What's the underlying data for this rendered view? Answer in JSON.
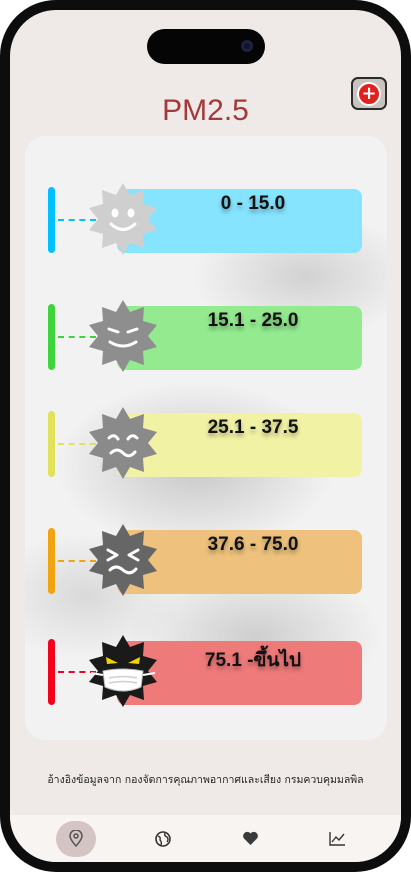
{
  "header": {
    "title": "PM2.5"
  },
  "levels": [
    {
      "range": "0 - 15.0",
      "color": "#00c0ff",
      "bar_color": "#86e4ff",
      "face": "smile-face-icon"
    },
    {
      "range": "15.1 - 25.0",
      "color": "#3fd43b",
      "bar_color": "#93ea8f",
      "face": "grin-face-icon"
    },
    {
      "range": "25.1 - 37.5",
      "color": "#e2e25a",
      "bar_color": "#f2f2a5",
      "face": "worried-face-icon"
    },
    {
      "range": "37.6 - 75.0",
      "color": "#f2a310",
      "bar_color": "#eec27c",
      "face": "squint-face-icon"
    },
    {
      "range": "75.1 -ขึ้นไป",
      "color": "#f2001c",
      "bar_color": "#ee7a79",
      "face": "masked-angry-face-icon"
    }
  ],
  "footer": {
    "source": "อ้างอิงข้อมูลจาก กองจัดการคุณภาพอากาศและเสียง กรมควบคุมมลพิล"
  },
  "nav": [
    {
      "icon": "location-pin-icon",
      "active": true
    },
    {
      "icon": "globe-icon",
      "active": false
    },
    {
      "icon": "heart-icon",
      "active": false
    },
    {
      "icon": "chart-line-icon",
      "active": false
    }
  ]
}
